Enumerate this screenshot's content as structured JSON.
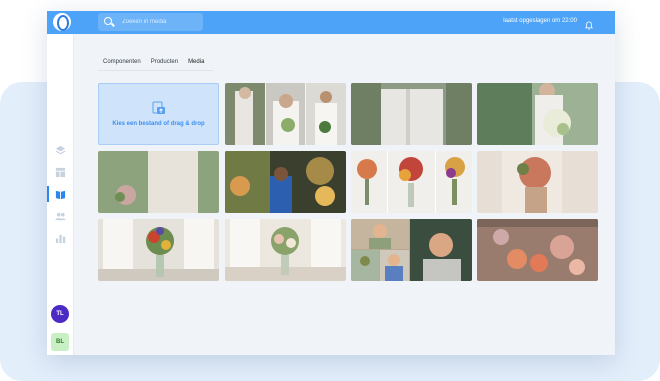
{
  "search": {
    "placeholder": "Zoeken in media"
  },
  "header": {
    "saved_status": "laatst opgeslagen om 22:00"
  },
  "tabs": [
    {
      "label": "Componenten"
    },
    {
      "label": "Producten"
    },
    {
      "label": "Media",
      "active": true
    }
  ],
  "upload": {
    "text": "Kies een bestand of drag & drop"
  },
  "avatars": {
    "user1": "TL",
    "user2": "BL"
  },
  "colors": {
    "accent": "#4da3f7",
    "active_tab": "#2d86f0",
    "avatar_purple": "#4b2bc4",
    "avatar_green": "#c9f0c4"
  },
  "icons": [
    "search-icon",
    "bell-icon",
    "layers-icon",
    "layout-icon",
    "book-icon",
    "users-icon",
    "chart-icon",
    "upload-icon"
  ]
}
